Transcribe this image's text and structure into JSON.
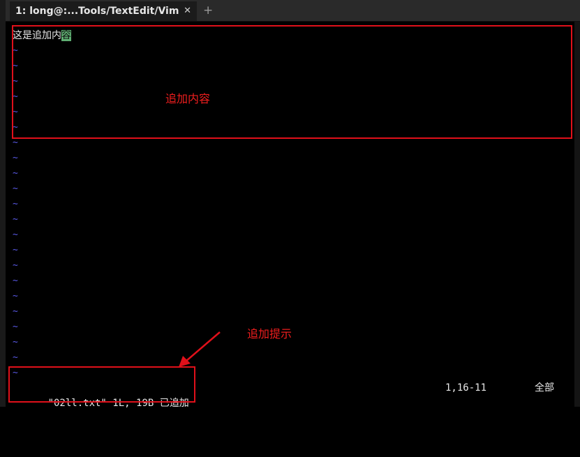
{
  "tabbar": {
    "tab_title": "1: long@:...Tools/TextEdit/Vim",
    "close_glyph": "✕",
    "new_tab_glyph": "+"
  },
  "editor": {
    "text_before_cursor": "这是追加内",
    "cursor_char": "容",
    "tilde": "~"
  },
  "statusline": {
    "message": "\"02ll.txt\" 1L, 19B 已追加",
    "position": "1,16-11",
    "scroll": "全部"
  },
  "annotations": {
    "content_label": "追加内容",
    "hint_label": "追加提示",
    "color": "#e0101a"
  },
  "colors": {
    "tilde": "#5a5ae8",
    "cursor_bg": "#5fae72",
    "background": "#000000"
  }
}
